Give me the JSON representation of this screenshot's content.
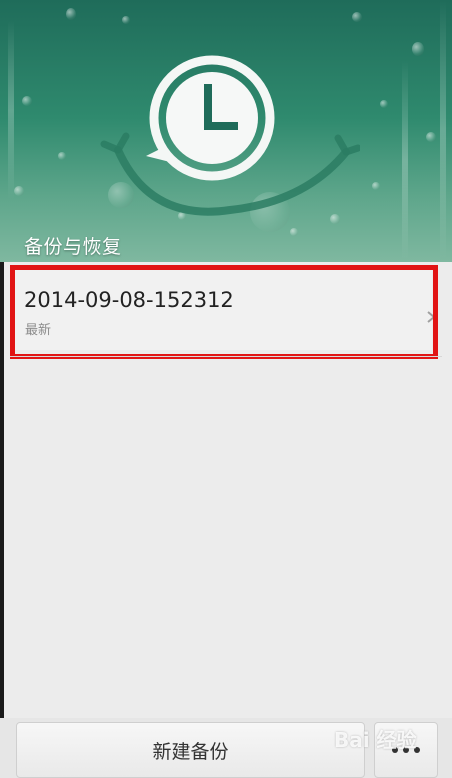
{
  "header": {
    "title": "备份与恢复",
    "icon": "clock-restore-icon"
  },
  "backups": [
    {
      "name": "2014-09-08-152312",
      "tag": "最新"
    }
  ],
  "bottom_bar": {
    "new_backup_label": "新建备份",
    "more_icon": "more-dots-icon"
  },
  "watermark": "Bai 经验",
  "colors": {
    "header_green": "#2f8a6e",
    "highlight_red": "#e11414"
  }
}
